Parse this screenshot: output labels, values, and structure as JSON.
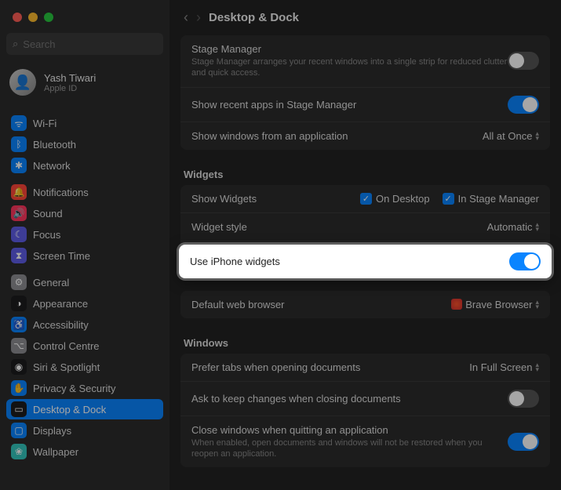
{
  "window": {
    "title": "Desktop & Dock"
  },
  "search": {
    "placeholder": "Search"
  },
  "account": {
    "name": "Yash Tiwari",
    "sub": "Apple ID"
  },
  "sidebar": {
    "group1": [
      {
        "label": "Wi-Fi",
        "color": "#0a84ff",
        "glyph": "ᯤ"
      },
      {
        "label": "Bluetooth",
        "color": "#0a84ff",
        "glyph": "ᛒ"
      },
      {
        "label": "Network",
        "color": "#0a84ff",
        "glyph": "✱"
      }
    ],
    "group2": [
      {
        "label": "Notifications",
        "color": "#ff453a",
        "glyph": "🔔"
      },
      {
        "label": "Sound",
        "color": "#ff375f",
        "glyph": "🔊"
      },
      {
        "label": "Focus",
        "color": "#5e5ce6",
        "glyph": "☾"
      },
      {
        "label": "Screen Time",
        "color": "#5e5ce6",
        "glyph": "⧗"
      }
    ],
    "group3": [
      {
        "label": "General",
        "color": "#8e8e93",
        "glyph": "⚙"
      },
      {
        "label": "Appearance",
        "color": "#1c1c1e",
        "glyph": "◑"
      },
      {
        "label": "Accessibility",
        "color": "#0a84ff",
        "glyph": "♿"
      },
      {
        "label": "Control Centre",
        "color": "#8e8e93",
        "glyph": "⌥"
      },
      {
        "label": "Siri & Spotlight",
        "color": "#1c1c1e",
        "glyph": "◉"
      },
      {
        "label": "Privacy & Security",
        "color": "#0a84ff",
        "glyph": "✋"
      },
      {
        "label": "Desktop & Dock",
        "color": "#1c1c1e",
        "glyph": "▭",
        "selected": true
      },
      {
        "label": "Displays",
        "color": "#0a84ff",
        "glyph": "▢"
      },
      {
        "label": "Wallpaper",
        "color": "#34c7bd",
        "glyph": "❀"
      }
    ]
  },
  "stageManager": {
    "title": "Stage Manager",
    "desc": "Stage Manager arranges your recent windows into a single strip for reduced clutter and quick access.",
    "recentApps": "Show recent apps in Stage Manager",
    "showWindows": "Show windows from an application",
    "showWindowsValue": "All at Once"
  },
  "widgets": {
    "heading": "Widgets",
    "showWidgets": "Show Widgets",
    "onDesktop": "On Desktop",
    "inStageManager": "In Stage Manager",
    "style": "Widget style",
    "styleValue": "Automatic",
    "useIphone": "Use iPhone widgets",
    "defaultBrowser": "Default web browser",
    "browserValue": "Brave Browser"
  },
  "windowsSection": {
    "heading": "Windows",
    "preferTabs": "Prefer tabs when opening documents",
    "preferTabsValue": "In Full Screen",
    "askKeep": "Ask to keep changes when closing documents",
    "closeQuit": "Close windows when quitting an application",
    "closeQuitDesc": "When enabled, open documents and windows will not be restored when you reopen an application."
  }
}
